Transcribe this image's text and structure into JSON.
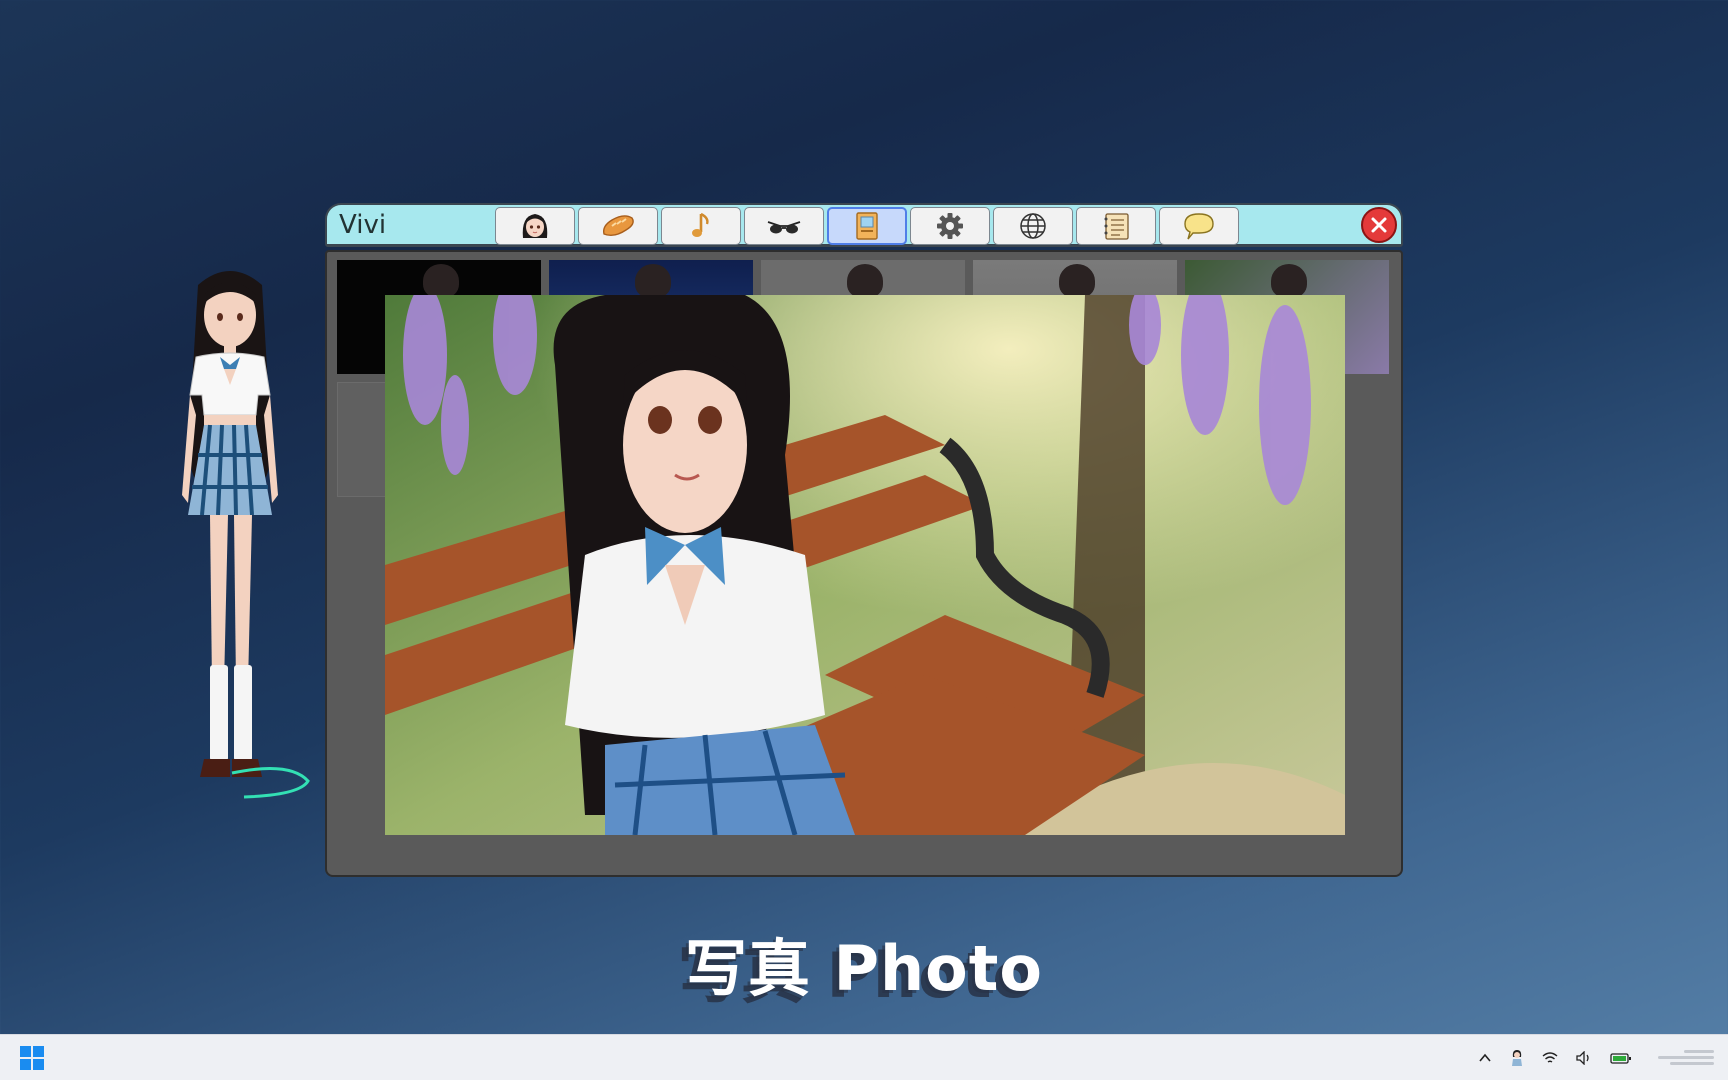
{
  "app": {
    "title": "Vivi",
    "toolbar": [
      {
        "icon": "character-portrait-icon",
        "active": false
      },
      {
        "icon": "bread-icon",
        "active": false
      },
      {
        "icon": "music-note-icon",
        "active": false
      },
      {
        "icon": "sunglasses-icon",
        "active": false
      },
      {
        "icon": "photo-album-icon",
        "active": true
      },
      {
        "icon": "gear-icon",
        "active": false
      },
      {
        "icon": "globe-icon",
        "active": false
      },
      {
        "icon": "notebook-icon",
        "active": false
      },
      {
        "icon": "speech-bubble-icon",
        "active": false
      }
    ],
    "close_icon": "close-icon",
    "gallery": {
      "thumbnail_count": 5,
      "selected_photo": "girl-on-park-bench"
    }
  },
  "caption": "写真 Photo",
  "taskbar": {
    "start_icon": "windows-start-icon",
    "tray_icons": [
      "chevron-up-icon",
      "character-tray-icon",
      "wifi-icon",
      "volume-icon",
      "battery-icon"
    ]
  },
  "colors": {
    "titlebar": "#a7e8ee",
    "window_body": "#5a5a5a",
    "active_tool": "#c7d9fb",
    "close": "#e43a3a",
    "desktop_top": "#16294a",
    "desktop_bottom": "#5680a8",
    "taskbar": "#eef0f4"
  }
}
